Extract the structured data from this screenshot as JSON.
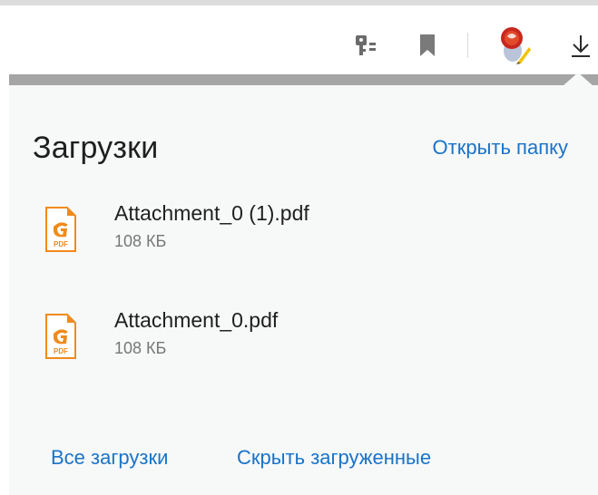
{
  "toolbar": {
    "icons": [
      "key-password-icon",
      "bookmark-icon",
      "extension-avatar-icon",
      "downloads-icon"
    ]
  },
  "downloads_panel": {
    "title": "Загрузки",
    "open_folder": "Открыть папку",
    "files": [
      {
        "name": "Attachment_0 (1).pdf",
        "size": "108 КБ",
        "type_label": "PDF"
      },
      {
        "name": "Attachment_0.pdf",
        "size": "108 КБ",
        "type_label": "PDF"
      }
    ],
    "all_downloads": "Все загрузки",
    "hide_downloaded": "Скрыть загруженные"
  },
  "colors": {
    "link": "#1a73c8",
    "pdf_orange": "#f08a1c",
    "panel_bg": "#f7f8f8"
  }
}
